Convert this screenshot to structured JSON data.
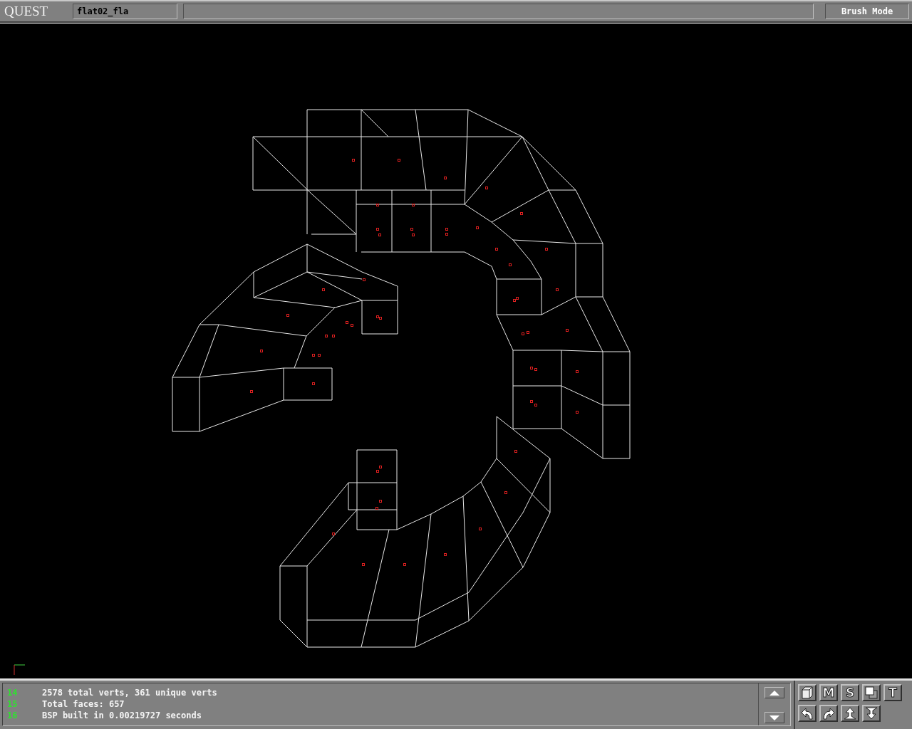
{
  "title_bar": {
    "logo": "QUEST",
    "map_name": "flat02_fla",
    "mode": "Brush Mode"
  },
  "console": {
    "lines": [
      {
        "number": "14",
        "text": "2578 total verts, 361 unique verts"
      },
      {
        "number": "15",
        "text": "Total faces: 657"
      },
      {
        "number": "16",
        "text": "BSP built in 0.00219727 seconds"
      }
    ]
  },
  "toolbar": {
    "rows": [
      [
        {
          "kind": "cube"
        },
        {
          "kind": "letter",
          "label": "M"
        },
        {
          "kind": "letter",
          "label": "S"
        },
        {
          "kind": "squares"
        },
        {
          "kind": "letter",
          "label": "T"
        }
      ],
      [
        {
          "kind": "undo"
        },
        {
          "kind": "redo"
        },
        {
          "kind": "up"
        },
        {
          "kind": "down"
        }
      ]
    ]
  }
}
